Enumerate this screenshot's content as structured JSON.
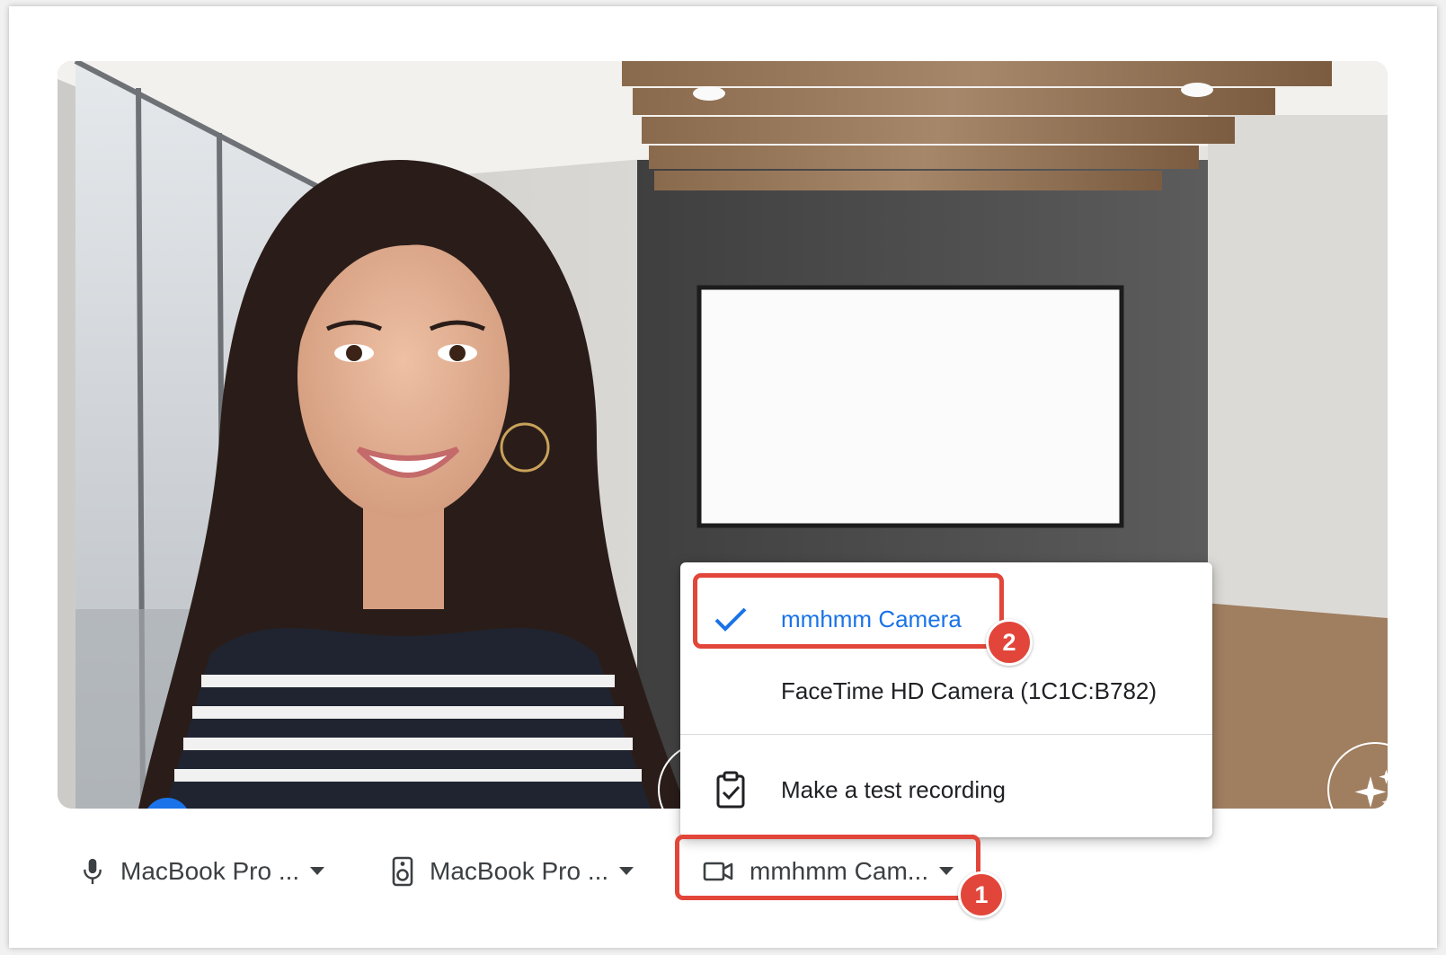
{
  "camera_menu": {
    "items": [
      {
        "label": "mmhmm Camera",
        "selected": true
      },
      {
        "label": "FaceTime HD Camera (1C1C:B782)",
        "selected": false
      }
    ],
    "test_recording_label": "Make a test recording"
  },
  "device_bar": {
    "microphone_label": "MacBook Pro ...",
    "speaker_label": "MacBook Pro ...",
    "camera_label": "mmhmm Cam..."
  },
  "annotations": {
    "badge_1": "1",
    "badge_2": "2"
  },
  "colors": {
    "accent_blue": "#1a73e8",
    "highlight_red": "#e2463a",
    "text_dark": "#202124",
    "text_gray": "#3c4043"
  },
  "icons": {
    "more": "more-vert-icon",
    "mic": "mic-icon",
    "effects": "sparkle-icon",
    "chat": "chat-bubble-icon",
    "check": "check-icon",
    "test": "clipboard-check-icon",
    "speaker": "speaker-icon",
    "camera": "videocam-icon",
    "caret": "caret-down-icon"
  }
}
